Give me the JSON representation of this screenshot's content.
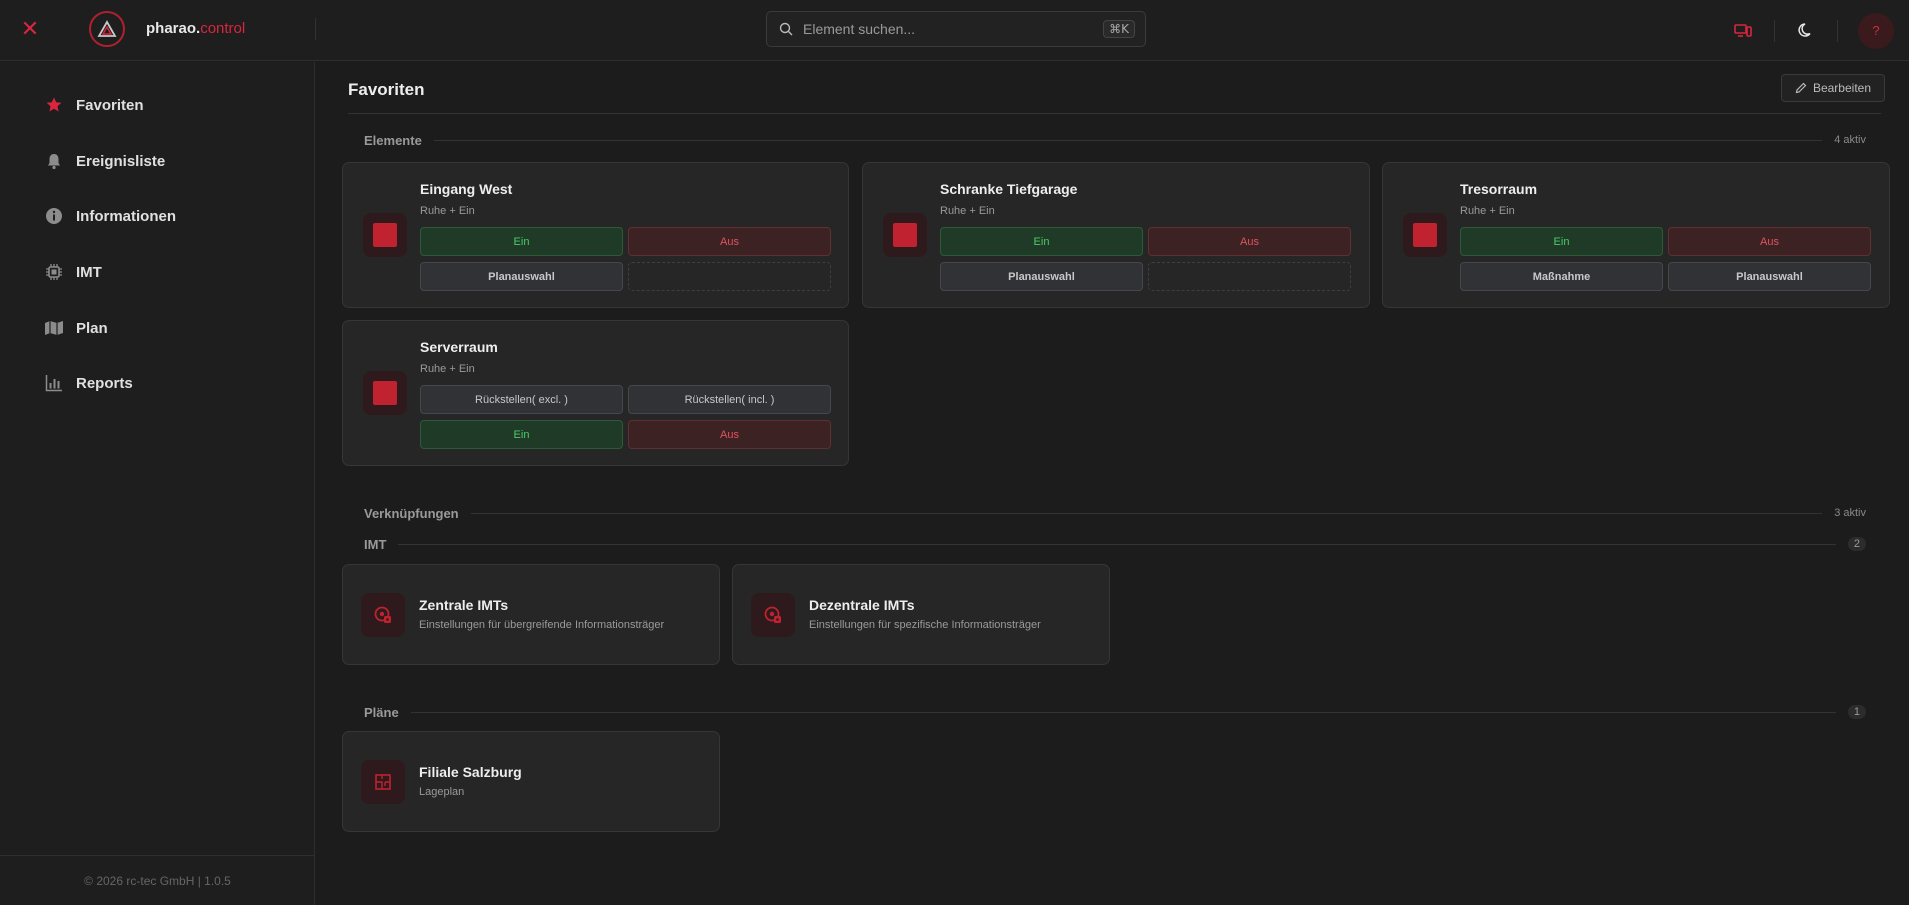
{
  "app": {
    "brand_main": "pharao.",
    "brand_accent": "control",
    "accent_color": "#d7263d"
  },
  "search": {
    "placeholder": "Element suchen...",
    "shortcut": "⌘K"
  },
  "user": {
    "avatar_text": "?"
  },
  "sidebar": {
    "items": [
      {
        "label": "Favoriten",
        "icon": "star-icon"
      },
      {
        "label": "Ereignisliste",
        "icon": "bell-icon"
      },
      {
        "label": "Informationen",
        "icon": "info-icon"
      },
      {
        "label": "IMT",
        "icon": "chip-icon"
      },
      {
        "label": "Plan",
        "icon": "map-icon"
      },
      {
        "label": "Reports",
        "icon": "bar-chart-icon"
      }
    ],
    "footer": "© 2026 rc-tec GmbH | 1.0.5"
  },
  "page": {
    "title": "Favoriten",
    "edit_label": "Bearbeiten"
  },
  "sections": {
    "elements": {
      "label": "Elemente",
      "count": "4 aktiv"
    },
    "links": {
      "label": "Verknüpfungen",
      "count": "3 aktiv"
    },
    "imt": {
      "label": "IMT",
      "count": "2"
    },
    "plans": {
      "label": "Pläne",
      "count": "1"
    }
  },
  "elements": [
    {
      "title": "Eingang West",
      "status": "Ruhe + Ein",
      "buttons": [
        "Ein",
        "Aus",
        "Planauswahl",
        ""
      ]
    },
    {
      "title": "Schranke Tiefgarage",
      "status": "Ruhe + Ein",
      "buttons": [
        "Ein",
        "Aus",
        "Planauswahl",
        ""
      ]
    },
    {
      "title": "Tresorraum",
      "status": "Ruhe + Ein",
      "buttons": [
        "Ein",
        "Aus",
        "Maßnahme",
        "Planauswahl"
      ]
    },
    {
      "title": "Serverraum",
      "status": "Ruhe + Ein",
      "buttons": [
        "Rückstellen( excl. )",
        "Rückstellen( incl. )",
        "Ein",
        "Aus"
      ]
    }
  ],
  "imt_links": [
    {
      "title": "Zentrale IMTs",
      "subtitle": "Einstellungen für übergreifende Informationsträger"
    },
    {
      "title": "Dezentrale IMTs",
      "subtitle": "Einstellungen für spezifische Informationsträger"
    }
  ],
  "plan_links": [
    {
      "title": "Filiale Salzburg",
      "subtitle": "Lageplan"
    }
  ]
}
